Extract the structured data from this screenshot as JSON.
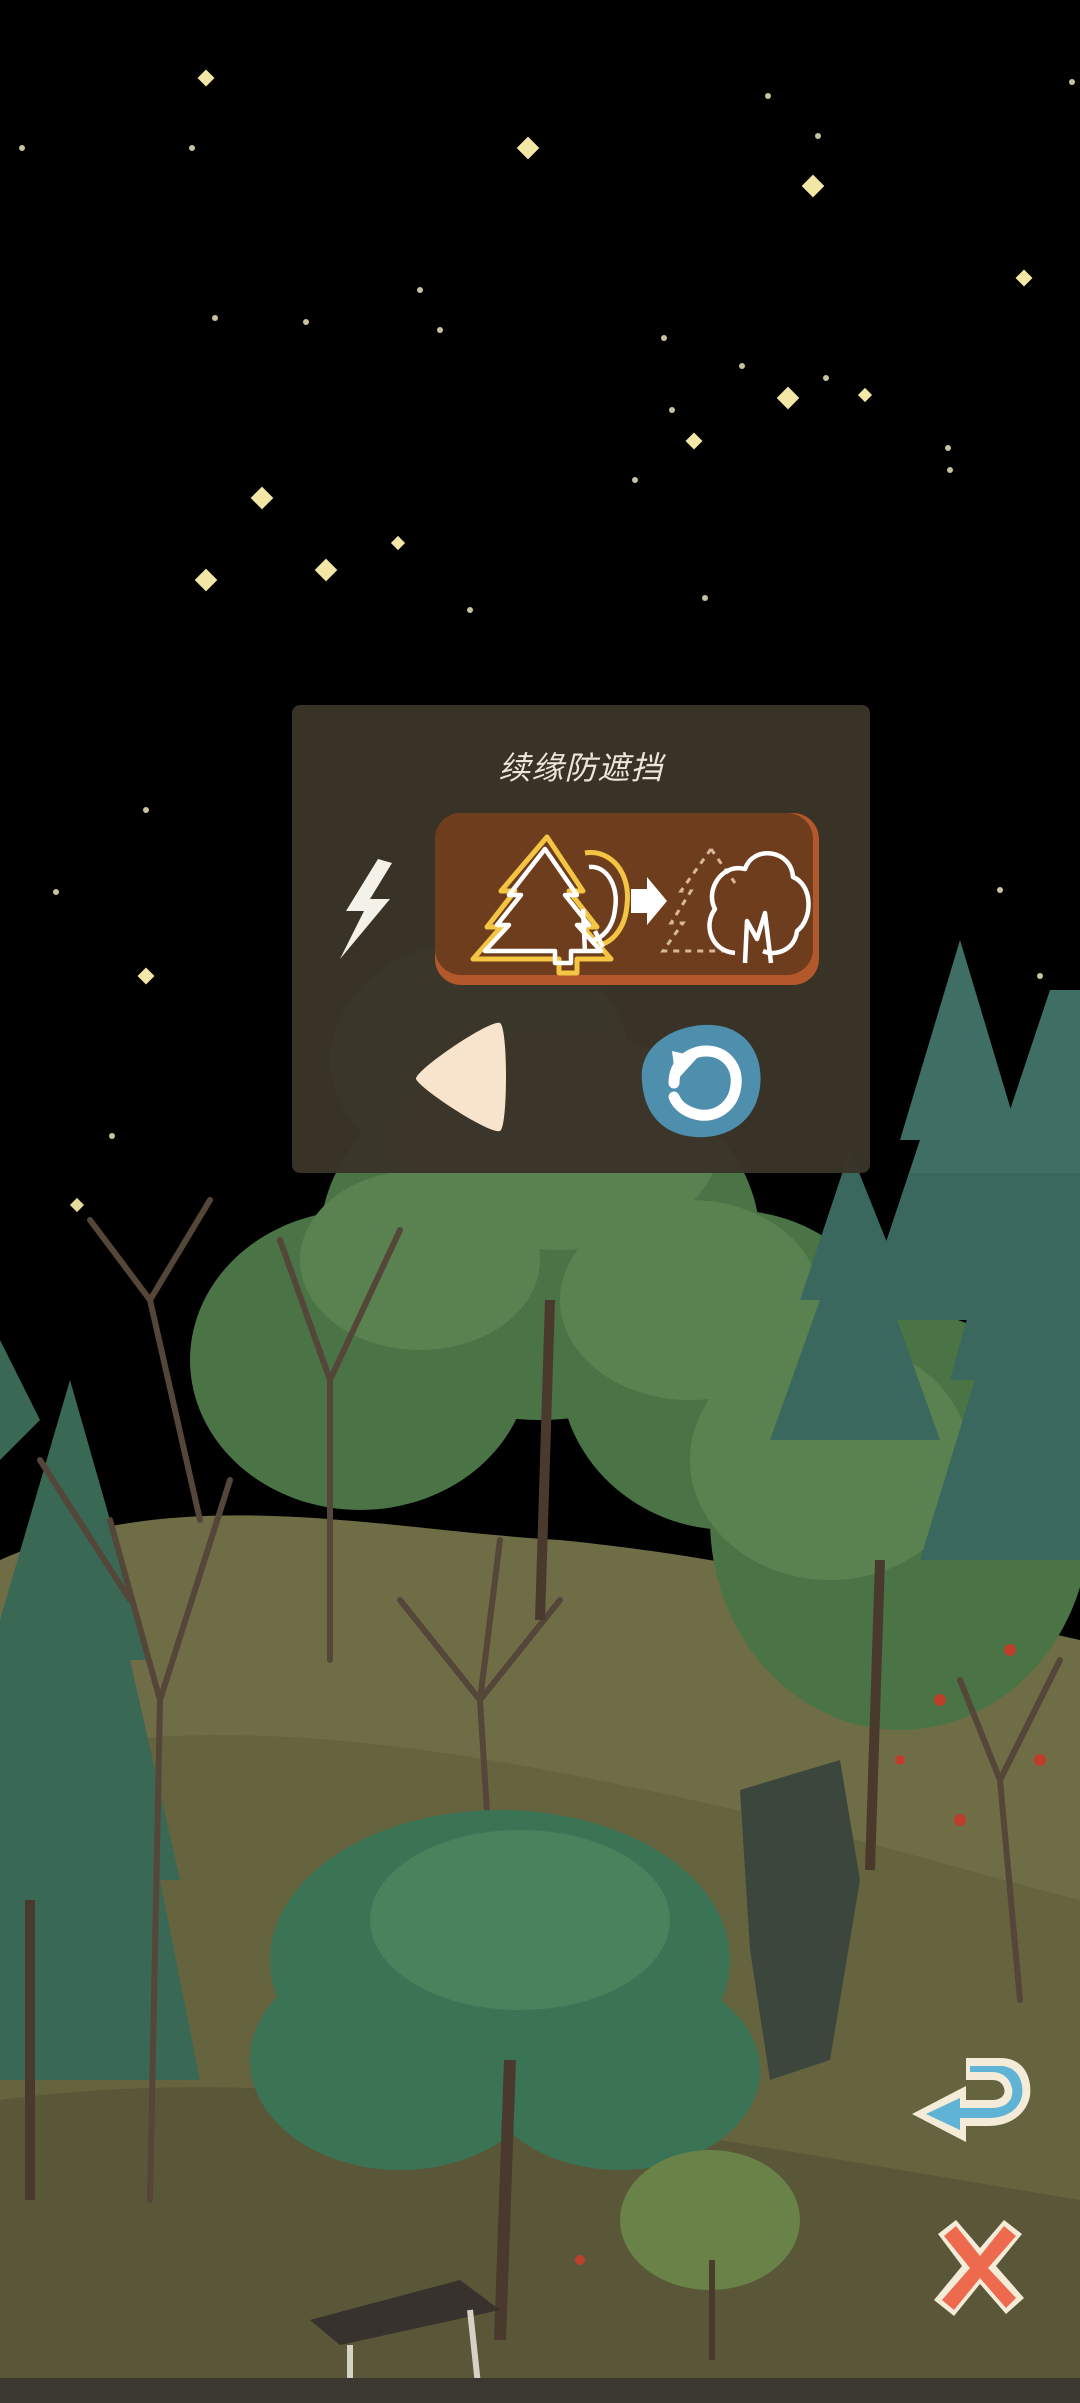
{
  "popup": {
    "title": "续缘防遮挡",
    "toggle_icon": "tree-occlusion-toggle-icon",
    "bolt_icon": "lightning-icon",
    "prev_icon": "triangle-left-icon",
    "reset_icon": "refresh-icon"
  },
  "controls": {
    "back_icon": "return-arrow-icon",
    "close_icon": "close-x-icon"
  },
  "colors": {
    "popup_bg": "#3a3428",
    "toggle_bg": "#6e3d1e",
    "toggle_border": "#b2582a",
    "reset_button": "#4e8fad",
    "back_arrow": "#5fb4d6",
    "close_x": "#ee6a4e",
    "prev_triangle": "#f8e3cc"
  }
}
